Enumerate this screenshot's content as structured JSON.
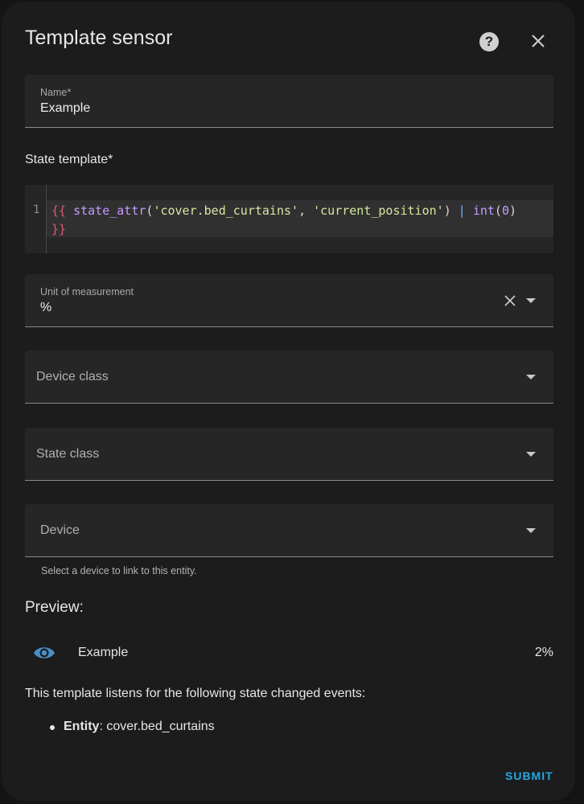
{
  "dialog": {
    "title": "Template sensor",
    "help_icon": "help-circle-icon",
    "close_icon": "close-icon"
  },
  "name_field": {
    "label": "Name*",
    "value": "Example"
  },
  "state_template": {
    "label": "State template*",
    "line_number": "1",
    "code_tokens": [
      {
        "cls": "tok-brace",
        "text": "{{"
      },
      {
        "cls": "",
        "text": " "
      },
      {
        "cls": "tok-func",
        "text": "state_attr"
      },
      {
        "cls": "",
        "text": "("
      },
      {
        "cls": "tok-str",
        "text": "'cover.bed_curtains'"
      },
      {
        "cls": "",
        "text": ", "
      },
      {
        "cls": "tok-str",
        "text": "'current_position'"
      },
      {
        "cls": "",
        "text": ") "
      },
      {
        "cls": "tok-pipe",
        "text": "|"
      },
      {
        "cls": "",
        "text": " "
      },
      {
        "cls": "tok-func",
        "text": "int"
      },
      {
        "cls": "",
        "text": "("
      },
      {
        "cls": "tok-num",
        "text": "0"
      },
      {
        "cls": "",
        "text": ") "
      },
      {
        "cls": "tok-brace",
        "text": "}}"
      }
    ]
  },
  "unit_field": {
    "label": "Unit of measurement",
    "value": "%"
  },
  "device_class_field": {
    "placeholder": "Device class"
  },
  "state_class_field": {
    "placeholder": "State class"
  },
  "device_field": {
    "placeholder": "Device",
    "helper": "Select a device to link to this entity."
  },
  "preview": {
    "title": "Preview:",
    "icon": "eye-icon",
    "entity_name": "Example",
    "state": "2%",
    "listens_text": "This template listens for the following state changed events:",
    "entity_label": "Entity",
    "entity_value": ": cover.bed_curtains"
  },
  "submit_label": "SUBMIT",
  "colors": {
    "accent": "#27a8e0",
    "icon_blue": "#4a8fc7"
  }
}
